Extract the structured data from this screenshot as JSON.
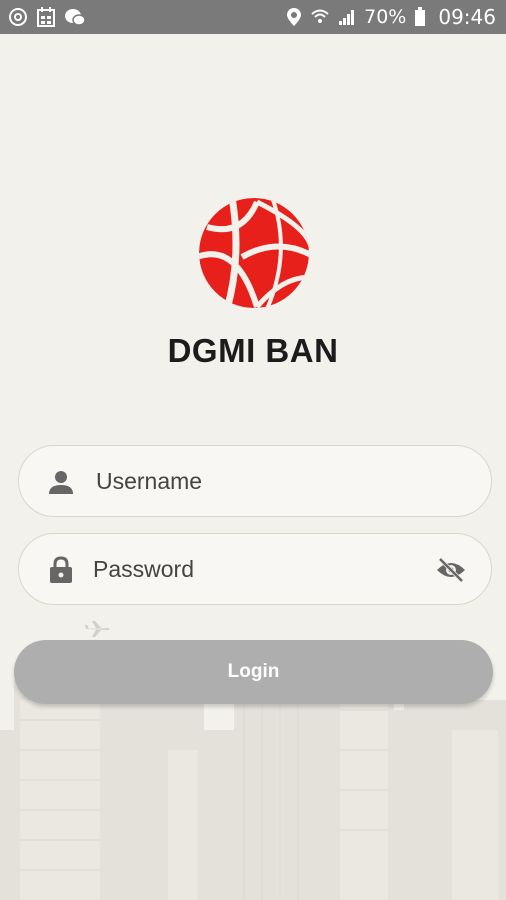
{
  "status_bar": {
    "icons_left": [
      "circle-at-icon",
      "calendar-icon",
      "chat-bubble-icon"
    ],
    "icons_right": [
      "location-icon",
      "wifi-icon",
      "signal-icon",
      "battery-icon"
    ],
    "battery": "70%",
    "time": "09:46"
  },
  "app": {
    "logo": "globe-logo",
    "title": "DGMI BAN",
    "brand_color": "#e8201c"
  },
  "login_form": {
    "username": {
      "value": "",
      "placeholder": "Username",
      "icon": "person-icon"
    },
    "password": {
      "value": "",
      "placeholder": "Password",
      "icon": "lock-icon",
      "toggle_icon": "eye-off-icon"
    },
    "login_label": "Login",
    "button_color": "#aeaeae"
  }
}
